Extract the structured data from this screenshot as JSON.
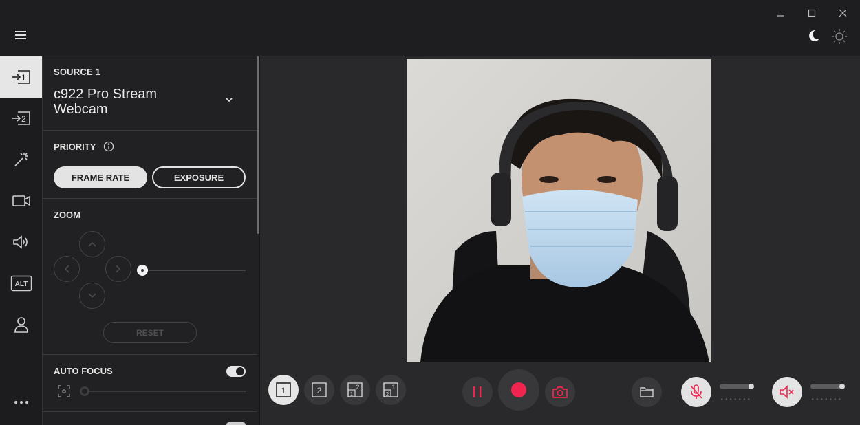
{
  "window": {
    "controls": [
      "minimize-icon",
      "maximize-icon",
      "close-icon"
    ]
  },
  "header": {
    "menu_icon": "hamburger-icon",
    "theme_icons": [
      "moon-icon",
      "sun-icon"
    ]
  },
  "rail": {
    "items": [
      {
        "icon": "source-1-icon",
        "active": true
      },
      {
        "icon": "source-2-icon",
        "active": false
      },
      {
        "icon": "magic-wand-icon",
        "active": false
      },
      {
        "icon": "camera-icon",
        "active": false
      },
      {
        "icon": "speaker-icon",
        "active": false
      },
      {
        "icon": "alt-icon",
        "label": "ALT",
        "active": false
      },
      {
        "icon": "user-icon",
        "active": false
      }
    ],
    "more": "•••"
  },
  "panel": {
    "source_label": "SOURCE 1",
    "source_name": "c922 Pro Stream Webcam",
    "priority_label": "PRIORITY",
    "priority_options": [
      "FRAME RATE",
      "EXPOSURE"
    ],
    "priority_selected": "FRAME RATE",
    "zoom_label": "ZOOM",
    "zoom_level": 0,
    "reset_label": "RESET",
    "autofocus_label": "AUTO FOCUS",
    "autofocus_on": true,
    "focus_level": 0
  },
  "layouts": [
    "1",
    "2",
    "1 2",
    "2 1"
  ],
  "layout_active": "1",
  "controls": {
    "pause_icon": "pause-icon",
    "record_icon": "record-icon",
    "snapshot_icon": "camera-icon",
    "folder_icon": "folder-icon",
    "mic_icon": "mic-muted-icon",
    "speaker_icon": "speaker-muted-icon"
  },
  "colors": {
    "accent": "#f0254f",
    "active_bg": "#e6e6e6",
    "panel_bg": "#212123"
  }
}
